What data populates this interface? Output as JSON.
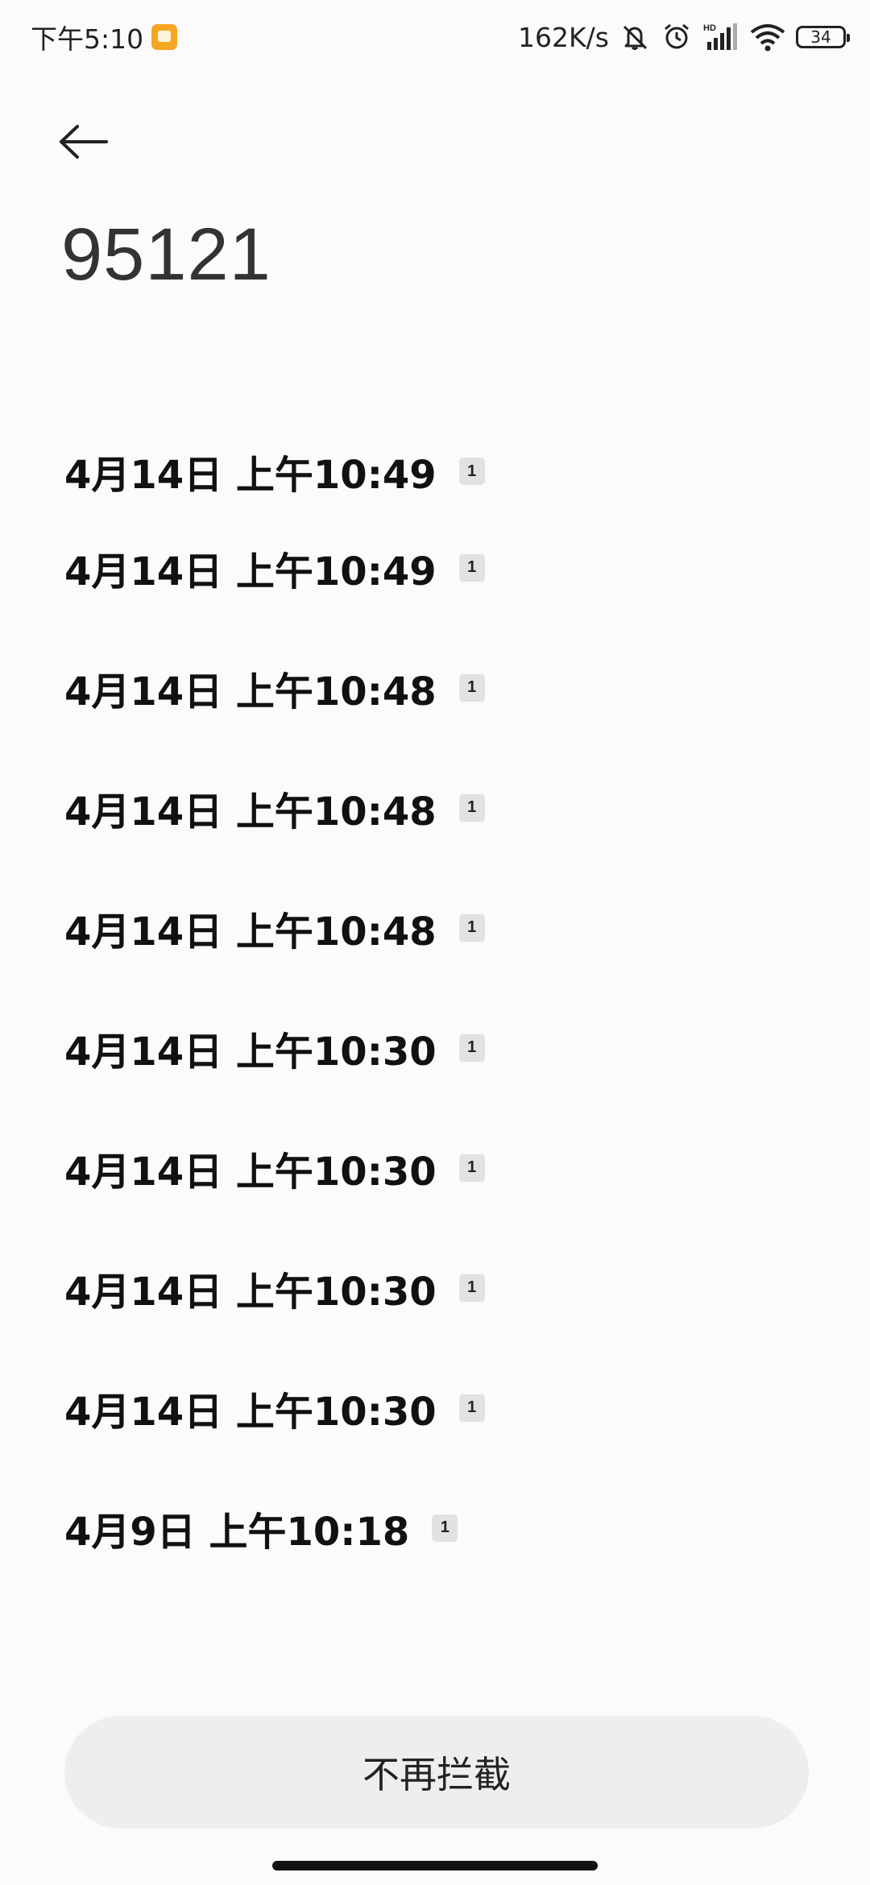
{
  "status_bar": {
    "time": "下午5:10",
    "net_speed": "162K/s",
    "battery": "34",
    "icons": [
      "mute-icon",
      "alarm-icon",
      "hd-signal-icon",
      "wifi-icon",
      "battery-icon"
    ]
  },
  "header": {
    "back_icon": "back-arrow-icon",
    "title": "95121"
  },
  "records": [
    {
      "time": "4月14日 上午10:49",
      "sim": "1"
    },
    {
      "time": "4月14日 上午10:49",
      "sim": "1"
    },
    {
      "time": "4月14日 上午10:48",
      "sim": "1"
    },
    {
      "time": "4月14日 上午10:48",
      "sim": "1"
    },
    {
      "time": "4月14日 上午10:48",
      "sim": "1"
    },
    {
      "time": "4月14日 上午10:30",
      "sim": "1"
    },
    {
      "time": "4月14日 上午10:30",
      "sim": "1"
    },
    {
      "time": "4月14日 上午10:30",
      "sim": "1"
    },
    {
      "time": "4月14日 上午10:30",
      "sim": "1"
    },
    {
      "time": "4月9日 上午10:18",
      "sim": "1"
    }
  ],
  "footer": {
    "unblock_label": "不再拦截"
  }
}
